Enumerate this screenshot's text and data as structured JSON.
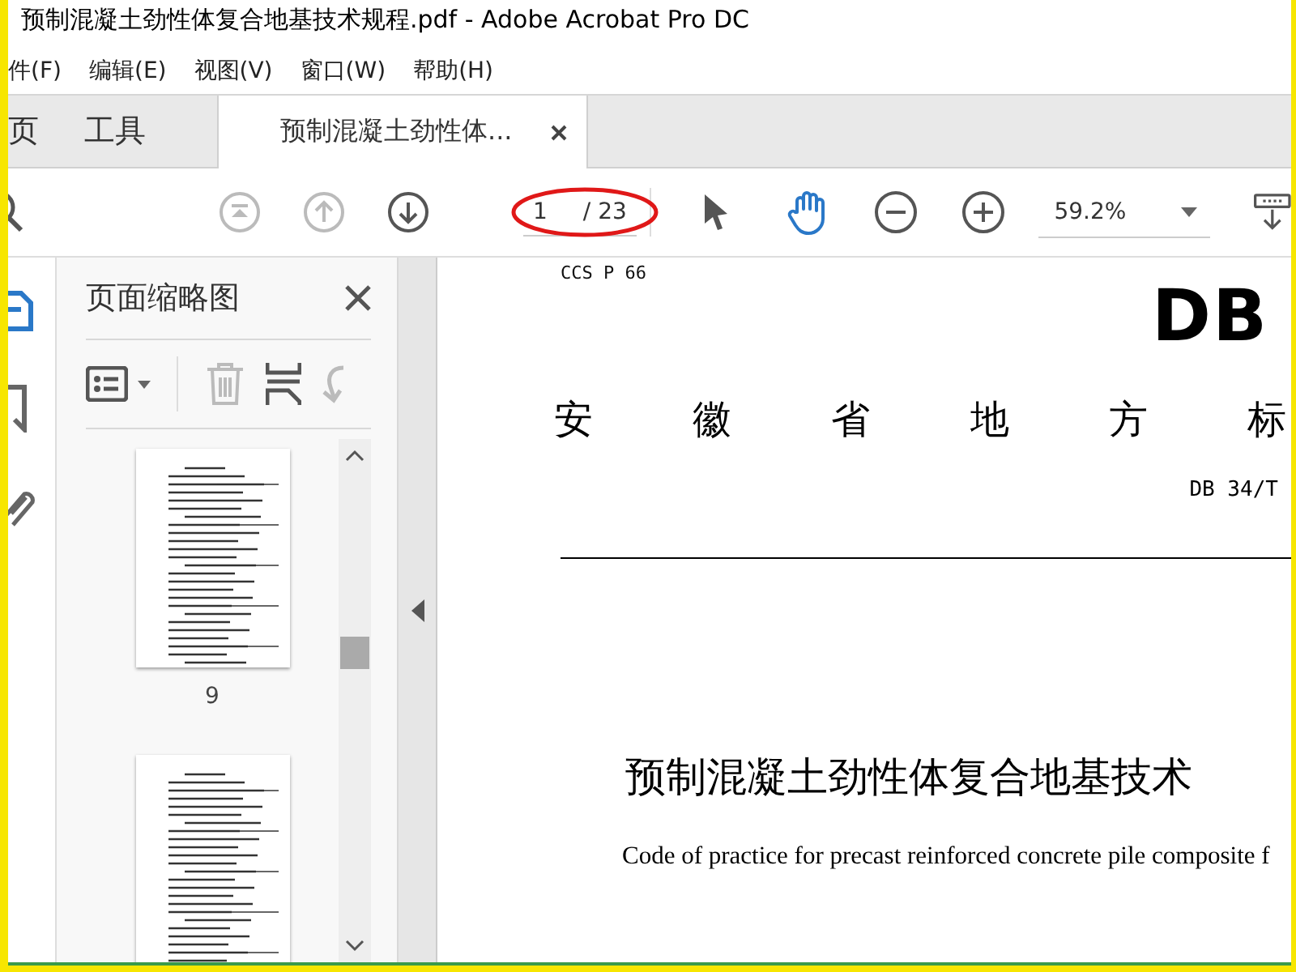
{
  "window": {
    "title": "预制混凝土劲性体复合地基技术规程.pdf - Adobe Acrobat Pro DC"
  },
  "menu": [
    "件(F)",
    "编辑(E)",
    "视图(V)",
    "窗口(W)",
    "帮助(H)"
  ],
  "tabs": [
    {
      "label": "页",
      "selected": false
    },
    {
      "label": "工具",
      "selected": false
    },
    {
      "label": "预制混凝土劲性体...",
      "selected": true
    }
  ],
  "toolbar": {
    "nav": [
      {
        "kind": "first",
        "disabled": true
      },
      {
        "kind": "prev",
        "disabled": true
      },
      {
        "kind": "next",
        "disabled": false
      }
    ],
    "page_current": "1",
    "page_total": "/ 23",
    "tools": [
      {
        "kind": "select",
        "selected": false
      },
      {
        "kind": "hand",
        "selected": true
      }
    ],
    "zoom": "59.2%"
  },
  "side_icons": [
    {
      "kind": "pages",
      "selected": true
    },
    {
      "kind": "bookmark",
      "selected": false
    },
    {
      "kind": "attachment",
      "selected": false
    }
  ],
  "panel": {
    "title": "页面缩略图",
    "tools": [
      {
        "kind": "options",
        "disabled": false
      },
      {
        "kind": "delete",
        "disabled": true
      },
      {
        "kind": "extract",
        "disabled": false
      },
      {
        "kind": "rotate",
        "disabled": true
      }
    ],
    "thumbnails": [
      {
        "kind": "page",
        "label": "9"
      },
      {
        "kind": "page"
      }
    ]
  },
  "document": {
    "code": "CCS P 66",
    "logo": "DB",
    "heading": "安徽省地方标",
    "number": "DB 34/T",
    "title": "预制混凝土劲性体复合地基技术",
    "subtitle": "Code of practice for precast reinforced concrete pile composite f"
  }
}
